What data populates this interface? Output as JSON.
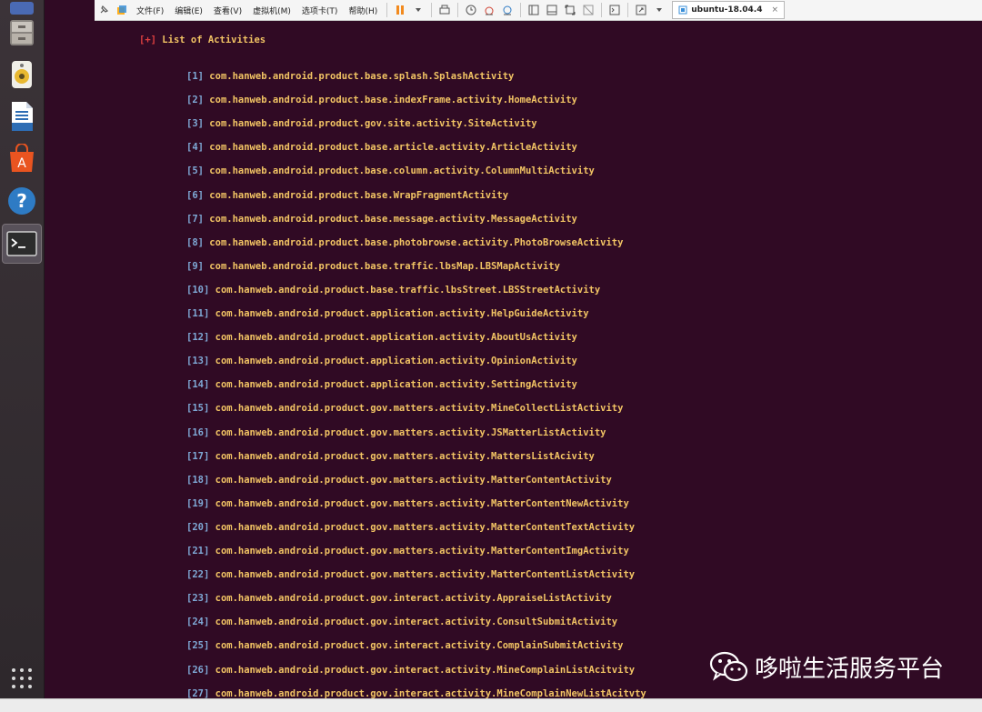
{
  "toolbar": {
    "menus": [
      "文件(F)",
      "编辑(E)",
      "查看(V)",
      "虚拟机(M)",
      "选项卡(T)",
      "帮助(H)"
    ],
    "vm_tab": "ubuntu-18.04.4"
  },
  "terminal": {
    "heading_prefix": "[+]",
    "heading": "List of Activities",
    "activities": [
      {
        "index": "[1]",
        "name": "com.hanweb.android.product.base.splash.SplashActivity"
      },
      {
        "index": "[2]",
        "name": "com.hanweb.android.product.base.indexFrame.activity.HomeActivity"
      },
      {
        "index": "[3]",
        "name": "com.hanweb.android.product.gov.site.activity.SiteActivity"
      },
      {
        "index": "[4]",
        "name": "com.hanweb.android.product.base.article.activity.ArticleActivity"
      },
      {
        "index": "[5]",
        "name": "com.hanweb.android.product.base.column.activity.ColumnMultiActivity"
      },
      {
        "index": "[6]",
        "name": "com.hanweb.android.product.base.WrapFragmentActivity"
      },
      {
        "index": "[7]",
        "name": "com.hanweb.android.product.base.message.activity.MessageActivity"
      },
      {
        "index": "[8]",
        "name": "com.hanweb.android.product.base.photobrowse.activity.PhotoBrowseActivity"
      },
      {
        "index": "[9]",
        "name": "com.hanweb.android.product.base.traffic.lbsMap.LBSMapActivity"
      },
      {
        "index": "[10]",
        "name": "com.hanweb.android.product.base.traffic.lbsStreet.LBSStreetActivity"
      },
      {
        "index": "[11]",
        "name": "com.hanweb.android.product.application.activity.HelpGuideActivity"
      },
      {
        "index": "[12]",
        "name": "com.hanweb.android.product.application.activity.AboutUsActivity"
      },
      {
        "index": "[13]",
        "name": "com.hanweb.android.product.application.activity.OpinionActivity"
      },
      {
        "index": "[14]",
        "name": "com.hanweb.android.product.application.activity.SettingActivity"
      },
      {
        "index": "[15]",
        "name": "com.hanweb.android.product.gov.matters.activity.MineCollectListActivity"
      },
      {
        "index": "[16]",
        "name": "com.hanweb.android.product.gov.matters.activity.JSMatterListActivity"
      },
      {
        "index": "[17]",
        "name": "com.hanweb.android.product.gov.matters.activity.MattersListAcivity"
      },
      {
        "index": "[18]",
        "name": "com.hanweb.android.product.gov.matters.activity.MatterContentActivity"
      },
      {
        "index": "[19]",
        "name": "com.hanweb.android.product.gov.matters.activity.MatterContentNewActivity"
      },
      {
        "index": "[20]",
        "name": "com.hanweb.android.product.gov.matters.activity.MatterContentTextActivity"
      },
      {
        "index": "[21]",
        "name": "com.hanweb.android.product.gov.matters.activity.MatterContentImgActivity"
      },
      {
        "index": "[22]",
        "name": "com.hanweb.android.product.gov.matters.activity.MatterContentListActivity"
      },
      {
        "index": "[23]",
        "name": "com.hanweb.android.product.gov.interact.activity.AppraiseListActivity"
      },
      {
        "index": "[24]",
        "name": "com.hanweb.android.product.gov.interact.activity.ConsultSubmitActivity"
      },
      {
        "index": "[25]",
        "name": "com.hanweb.android.product.gov.interact.activity.ComplainSubmitActivity"
      },
      {
        "index": "[26]",
        "name": "com.hanweb.android.product.gov.interact.activity.MineComplainListAcitvity"
      },
      {
        "index": "[27]",
        "name": "com.hanweb.android.product.gov.interact.activity.MineComplainNewListAcitvty"
      }
    ]
  },
  "watermark": {
    "text": "哆啦生活服务平台"
  },
  "colors": {
    "terminal_bg": "#300a24",
    "activity_text": "#f2c464",
    "index_text": "#7fa9d6",
    "prefix_red": "#e04040"
  }
}
